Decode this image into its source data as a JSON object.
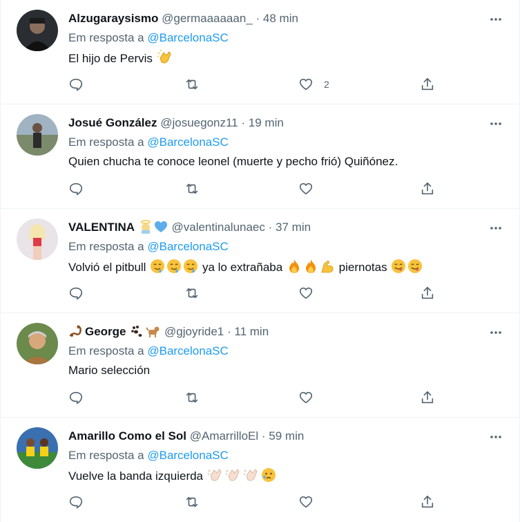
{
  "reply_prefix": "Em resposta a",
  "colors": {
    "accent": "#1d9bf0",
    "muted": "#536471",
    "text": "#0f1419"
  },
  "tweets": [
    {
      "name": "Alzugaraysismo",
      "handle": "@germaaaaaan_",
      "separator": "·",
      "time": "48 min",
      "mention": "@BarcelonaSC",
      "text": "El hijo de Pervis",
      "like_count": "2"
    },
    {
      "name": "Josué González",
      "handle": "@josuegonz11",
      "separator": "·",
      "time": "19 min",
      "mention": "@BarcelonaSC",
      "text": "Quien chucha te conoce leonel (muerte y pecho frió) Quiñónez.",
      "like_count": ""
    },
    {
      "name": "VALENTINA",
      "handle": "@valentinalunaec",
      "separator": "·",
      "time": "37 min",
      "mention": "@BarcelonaSC",
      "text_a": "Volvió el pitbull",
      "text_b": "ya lo extrañaba",
      "text_c": "piernotas",
      "like_count": ""
    },
    {
      "name": "George",
      "handle": "@gjoyride1",
      "separator": "·",
      "time": "11 min",
      "mention": "@BarcelonaSC",
      "text": "Mario selección",
      "like_count": ""
    },
    {
      "name": "Amarillo Como el Sol",
      "handle": "@AmarrilloEl",
      "separator": "·",
      "time": "59 min",
      "mention": "@BarcelonaSC",
      "text": "Vuelve la banda izquierda",
      "like_count": ""
    }
  ]
}
